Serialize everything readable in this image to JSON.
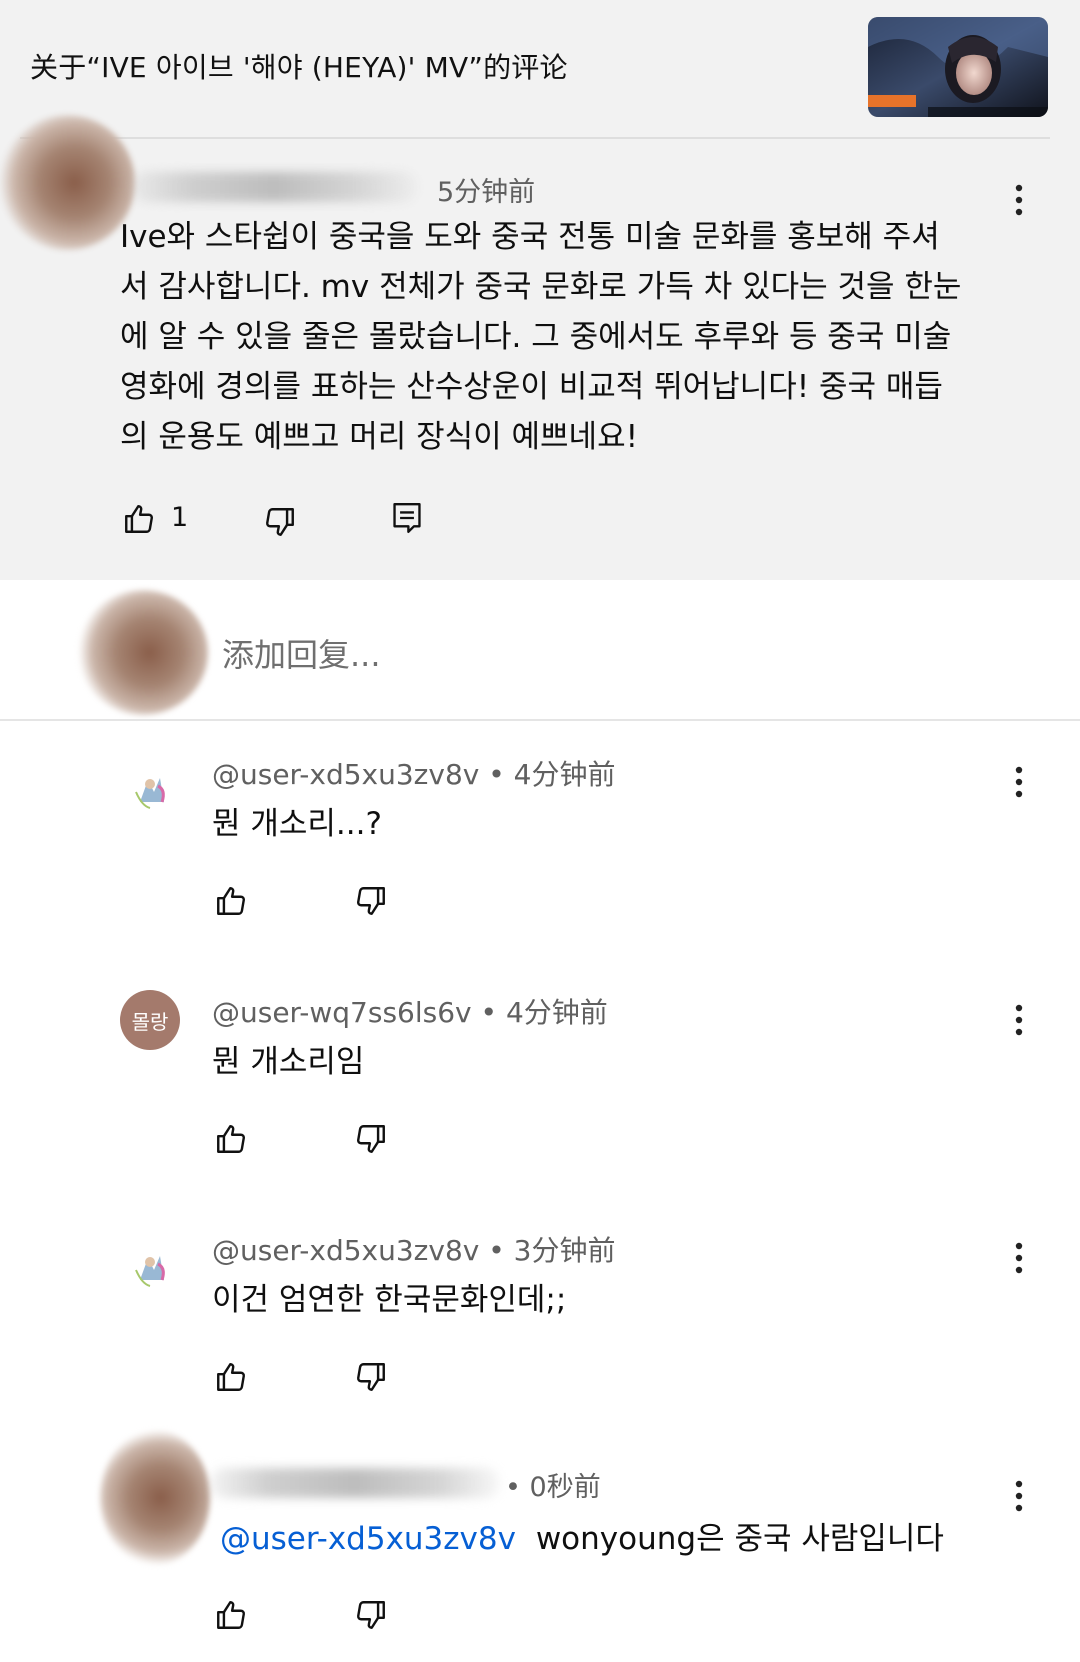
{
  "header": {
    "title": "关于“IVE 아이브 '해야 (HEYA)' MV”的评论",
    "thumbnail_label": "video-thumbnail"
  },
  "main_comment": {
    "time": "5分钟前",
    "text": "Ive와 스타쉽이 중국을 도와 중국 전통 미술 문화를 홍보해 주셔\n서 감사합니다. mv 전체가 중국 문화로 가득 차 있다는 것을 한눈\n에 알 수 있을 줄은 몰랐습니다. 그 중에서도 후루와 등 중국 미술\n영화에 경의를 표하는 산수상운이 비교적 뛰어납니다! 중국 매듭\n의 운용도 예쁘고 머리 장식이 예쁘네요!",
    "like_count": "1"
  },
  "reply_input": {
    "placeholder": "添加回复..."
  },
  "replies": [
    {
      "author": "@user-xd5xu3zv8v",
      "time": "4分钟前",
      "text": "뭔 개소리...?"
    },
    {
      "author": "@user-wq7ss6ls6v",
      "time": "4分钟前",
      "text": "뭔 개소리임",
      "avatar_text": "몰랑"
    },
    {
      "author": "@user-xd5xu3zv8v",
      "time": "3分钟前",
      "text": "이건 엄연한 한국문화인데;;"
    },
    {
      "time": "0秒前",
      "mention": "@user-xd5xu3zv8v",
      "text": "wonyoung은 중국 사람입니다"
    }
  ],
  "separators": {
    "dot": "•"
  },
  "colors": {
    "top_background": "#f2f2f2",
    "mention": "#065fd4",
    "meta_text": "#606060"
  },
  "icons": [
    "thumb-up-icon",
    "thumb-down-icon",
    "reply-icon",
    "more-vert-icon"
  ]
}
